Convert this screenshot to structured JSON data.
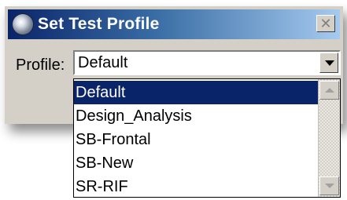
{
  "window": {
    "title": "Set Test Profile",
    "close_glyph": "✕"
  },
  "profile": {
    "label": "Profile:",
    "selected_value": "Default"
  },
  "dropdown": {
    "options": [
      {
        "label": "Default",
        "selected": true
      },
      {
        "label": "Design_Analysis",
        "selected": false
      },
      {
        "label": "SB-Frontal",
        "selected": false
      },
      {
        "label": "SB-New",
        "selected": false
      },
      {
        "label": "SR-RIF",
        "selected": false
      }
    ]
  },
  "colors": {
    "titlebar_start": "#0a246a",
    "titlebar_end": "#a6caf0",
    "selection_bg": "#0a246a",
    "window_bg": "#d4d0c8"
  },
  "icons": {
    "app": "app-logo-icon",
    "close": "close-icon",
    "dropdown_arrow": "chevron-down-icon",
    "scroll_up": "scroll-up-icon",
    "scroll_down": "scroll-down-icon"
  }
}
